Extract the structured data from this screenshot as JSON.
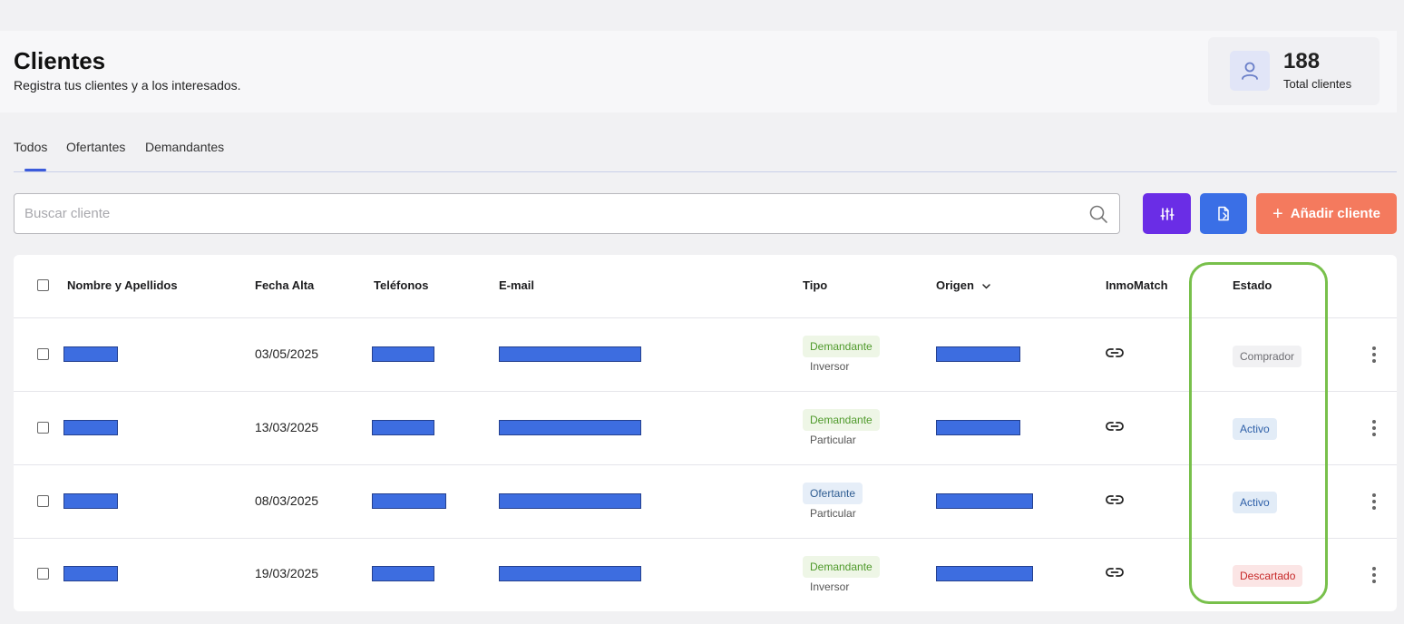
{
  "header": {
    "title": "Clientes",
    "subtitle": "Registra tus clientes y a los interesados."
  },
  "stats": {
    "icon": "user-icon",
    "count": "188",
    "label": "Total clientes"
  },
  "tabs": [
    {
      "label": "Todos",
      "active": true
    },
    {
      "label": "Ofertantes",
      "active": false
    },
    {
      "label": "Demandantes",
      "active": false
    }
  ],
  "search": {
    "placeholder": "Buscar cliente",
    "value": ""
  },
  "toolbar": {
    "filter_icon": "sliders-icon",
    "export_icon": "file-export-icon",
    "add_label": "Añadir cliente"
  },
  "table": {
    "columns": [
      "Nombre y Apellidos",
      "Fecha Alta",
      "Teléfonos",
      "E-mail",
      "Tipo",
      "Origen",
      "InmoMatch",
      "Estado"
    ],
    "sorted_column": "Origen",
    "rows": [
      {
        "nombre": "",
        "fecha": "03/05/2025",
        "telefono": "",
        "email": "",
        "tipo": "Demandante",
        "subtipo": "Inversor",
        "origen": "",
        "estado": "Comprador"
      },
      {
        "nombre": "",
        "fecha": "13/03/2025",
        "telefono": "",
        "email": "",
        "tipo": "Demandante",
        "subtipo": "Particular",
        "origen": "",
        "estado": "Activo"
      },
      {
        "nombre": "",
        "fecha": "08/03/2025",
        "telefono": "",
        "email": "",
        "tipo": "Ofertante",
        "subtipo": "Particular",
        "origen": "",
        "estado": "Activo"
      },
      {
        "nombre": "",
        "fecha": "19/03/2025",
        "telefono": "",
        "email": "",
        "tipo": "Demandante",
        "subtipo": "Inversor",
        "origen": "",
        "estado": "Descartado"
      }
    ]
  },
  "colors": {
    "accent_tab": "#3b5bdb",
    "filter_button": "#6a2de6",
    "export_button": "#3a6fe6",
    "add_button": "#f47a5e",
    "highlight": "#78c04b",
    "redaction": "#3d6de0"
  }
}
